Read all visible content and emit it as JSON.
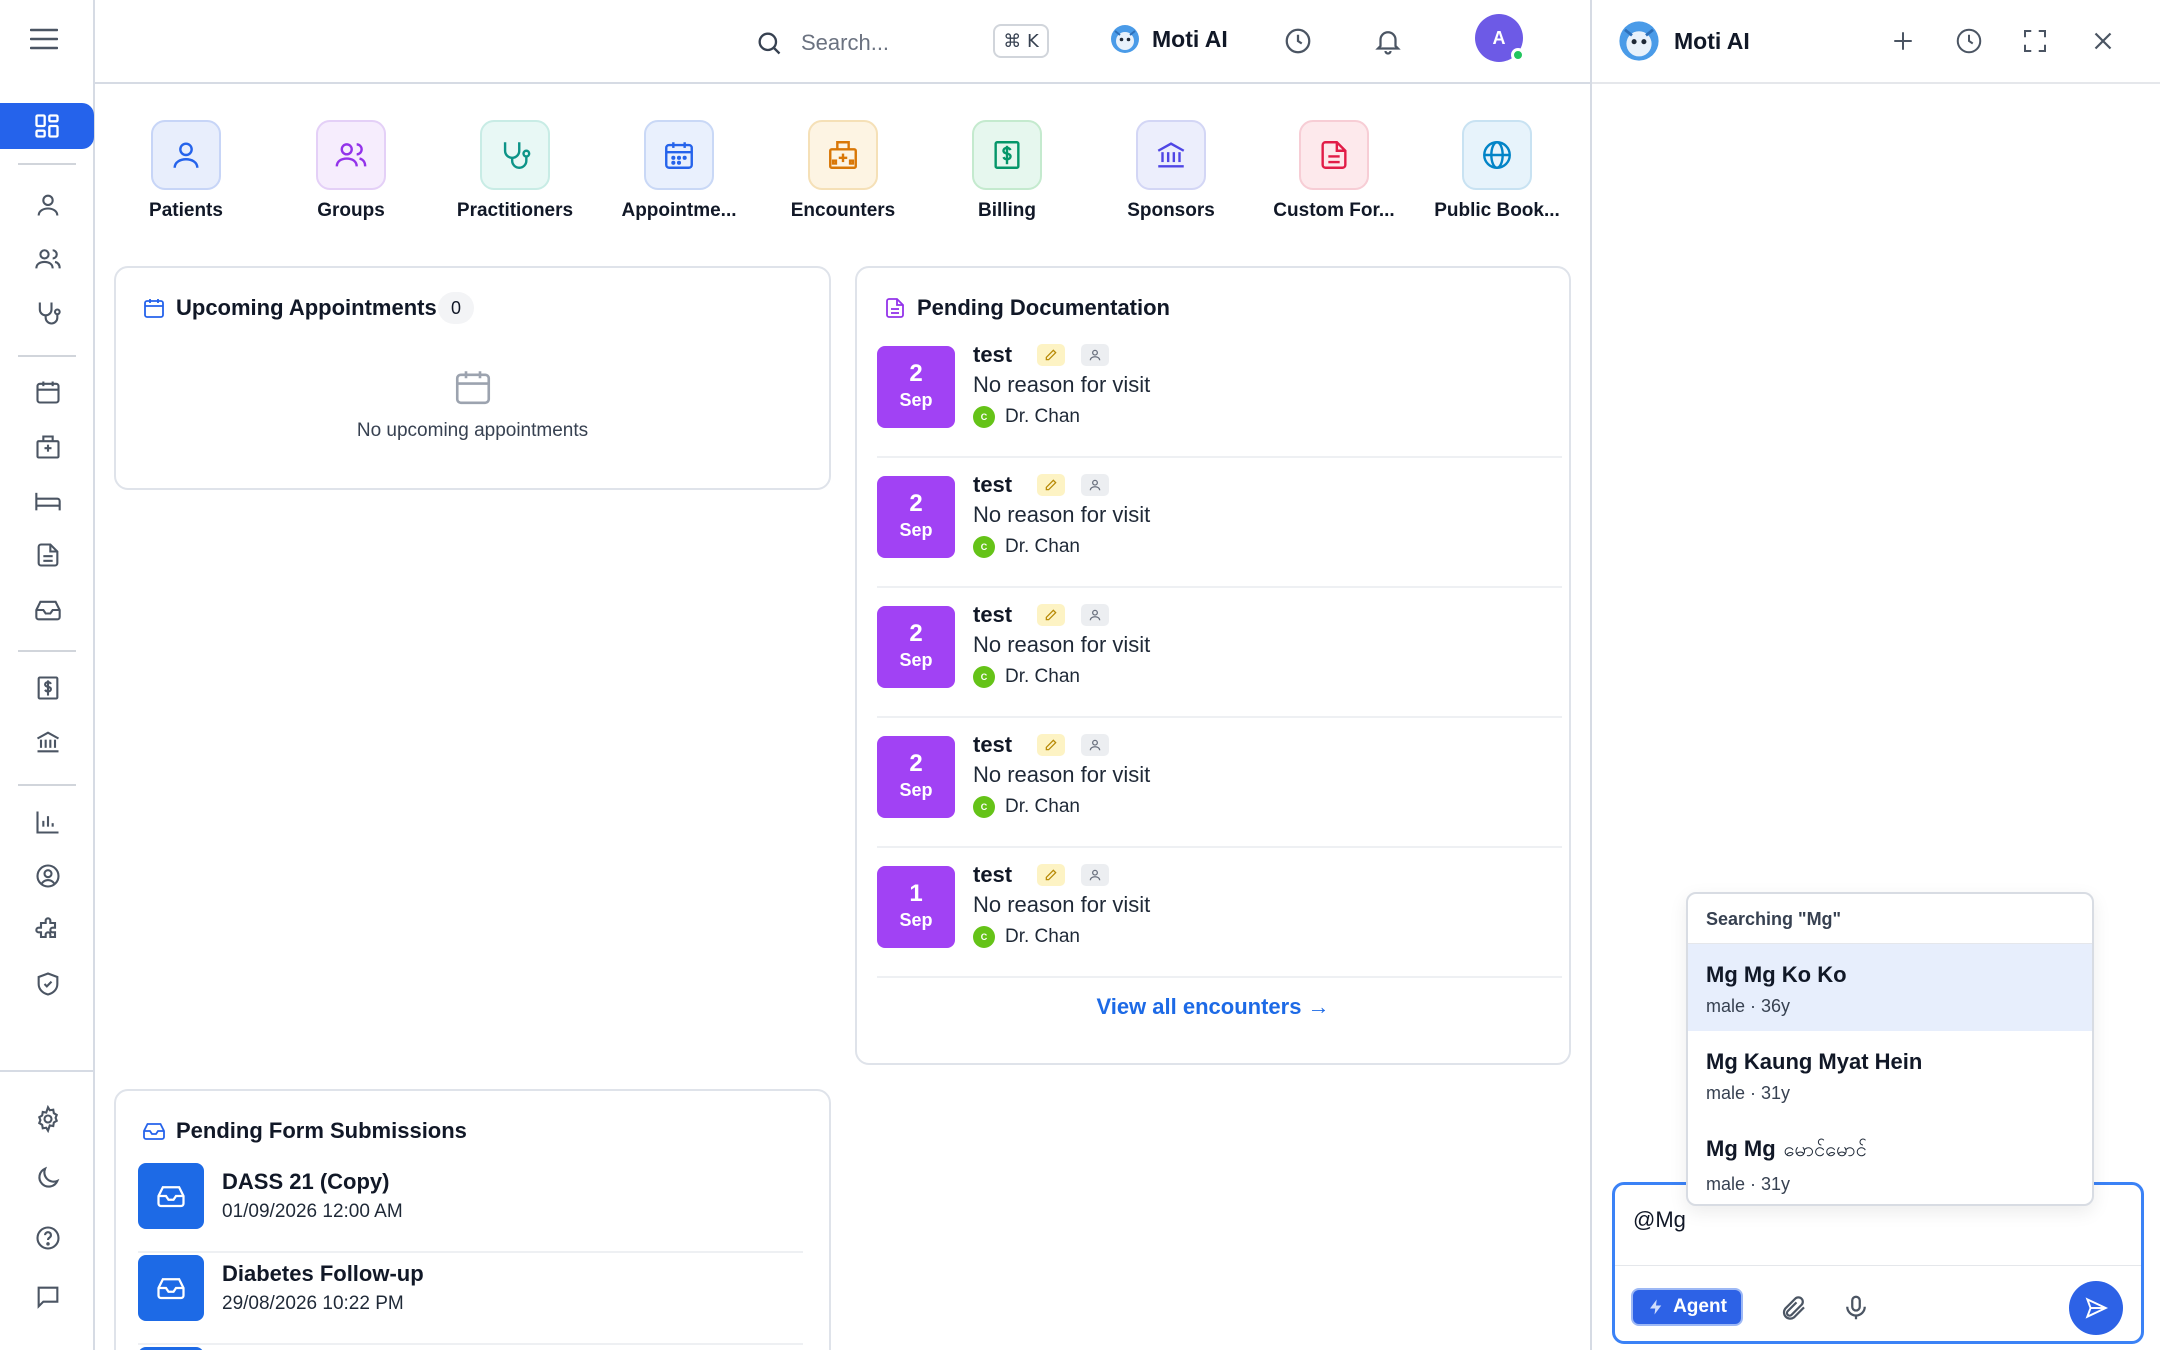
{
  "topbar": {
    "search_placeholder": "Search...",
    "shortcut": "⌘ K",
    "assistant_name": "Moti AI",
    "avatar_initial": "A"
  },
  "quick_nav": [
    {
      "label": "Patients",
      "icon": "user-icon",
      "color": "#2563eb",
      "bg": "#e8eefc",
      "border": "#c7d5f7"
    },
    {
      "label": "Groups",
      "icon": "users-icon",
      "color": "#9333ea",
      "bg": "#f6edfd",
      "border": "#e4d0f7"
    },
    {
      "label": "Practitioners",
      "icon": "stethoscope-icon",
      "color": "#0d9488",
      "bg": "#e8f8f5",
      "border": "#c8ece5"
    },
    {
      "label": "Appointme...",
      "icon": "calendar-icon",
      "color": "#2563eb",
      "bg": "#e9f0fd",
      "border": "#c9d8f6"
    },
    {
      "label": "Encounters",
      "icon": "hospital-icon",
      "color": "#d97706",
      "bg": "#fdf4e3",
      "border": "#f5e0b7"
    },
    {
      "label": "Billing",
      "icon": "receipt-dollar-icon",
      "color": "#059669",
      "bg": "#e6f7ee",
      "border": "#c4eace"
    },
    {
      "label": "Sponsors",
      "icon": "bank-icon",
      "color": "#4f46e5",
      "bg": "#eceefc",
      "border": "#d3d6f5"
    },
    {
      "label": "Custom For...",
      "icon": "file-text-icon",
      "color": "#e11d48",
      "bg": "#fde9ec",
      "border": "#f7cdd5"
    },
    {
      "label": "Public Book...",
      "icon": "globe-icon",
      "color": "#0284c7",
      "bg": "#e7f3fb",
      "border": "#c8e2f2"
    }
  ],
  "upcoming": {
    "title": "Upcoming Appointments",
    "count": "0",
    "empty_text": "No upcoming appointments"
  },
  "pending_docs": {
    "title": "Pending Documentation",
    "items": [
      {
        "day": "2",
        "month": "Sep",
        "title": "test",
        "reason": "No reason for visit",
        "doctor": "Dr. Chan",
        "initial": "C"
      },
      {
        "day": "2",
        "month": "Sep",
        "title": "test",
        "reason": "No reason for visit",
        "doctor": "Dr. Chan",
        "initial": "C"
      },
      {
        "day": "2",
        "month": "Sep",
        "title": "test",
        "reason": "No reason for visit",
        "doctor": "Dr. Chan",
        "initial": "C"
      },
      {
        "day": "2",
        "month": "Sep",
        "title": "test",
        "reason": "No reason for visit",
        "doctor": "Dr. Chan",
        "initial": "C"
      },
      {
        "day": "1",
        "month": "Sep",
        "title": "test",
        "reason": "No reason for visit",
        "doctor": "Dr. Chan",
        "initial": "C"
      }
    ],
    "view_all": "View all encounters →"
  },
  "pending_forms": {
    "title": "Pending Form Submissions",
    "items": [
      {
        "name": "DASS 21 (Copy)",
        "date": "01/09/2026 12:00 AM"
      },
      {
        "name": "Diabetes Follow-up",
        "date": "29/08/2026 10:22 PM"
      }
    ]
  },
  "ai_panel": {
    "title": "Moti AI",
    "search_header": "Searching \"Mg\"",
    "results": [
      {
        "name": "Mg Mg Ko Ko",
        "alt": "",
        "meta": "male · 36y"
      },
      {
        "name": "Mg Kaung Myat Hein",
        "alt": "",
        "meta": "male · 31y"
      },
      {
        "name": "Mg Mg",
        "alt": "မောင်မောင်",
        "meta": "male · 31y"
      }
    ],
    "input_value": "@Mg",
    "agent_label": "Agent"
  },
  "colors": {
    "primary": "#2563eb",
    "date_badge": "#a142f4",
    "doctor_dot": "#65c318",
    "form_icon": "#1d6ae6"
  }
}
